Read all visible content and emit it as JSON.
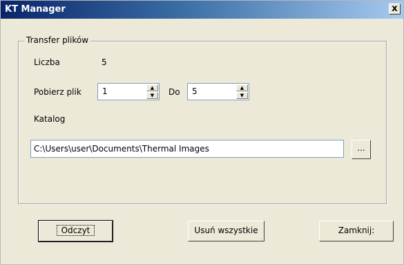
{
  "window": {
    "title": "KT Manager",
    "close_label": "x"
  },
  "group": {
    "legend": "Transfer plików"
  },
  "fields": {
    "count_label": "Liczba",
    "count_value": "5",
    "download_label": "Pobierz plik",
    "from_value": "1",
    "to_label": "Do",
    "to_value": "5",
    "folder_label": "Katalog",
    "folder_path": "C:\\Users\\user\\Documents\\Thermal Images",
    "browse_label": "..."
  },
  "buttons": {
    "read": "Odczyt",
    "delete_all": "Usuń wszystkie",
    "close": "Zamknij:"
  },
  "colors": {
    "titlebar_start": "#0a246a",
    "titlebar_end": "#a6caf0",
    "window_bg": "#ece9d8"
  }
}
